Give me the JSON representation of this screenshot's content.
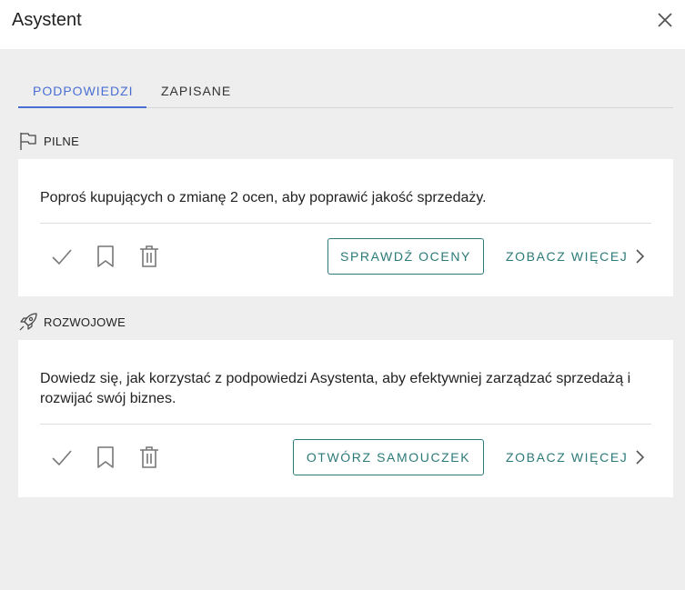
{
  "header": {
    "title": "Asystent",
    "close_icon": "close-icon"
  },
  "tabs": [
    {
      "label": "PODPOWIEDZI",
      "active": true
    },
    {
      "label": "ZAPISANE",
      "active": false
    }
  ],
  "colors": {
    "accent": "#4a6fd3",
    "teal": "#2b7a78",
    "background": "#eeeeee"
  },
  "sections": [
    {
      "label": "PILNE",
      "icon": "flag-icon",
      "card": {
        "text": "Poproś kupujących o zmianę 2 ocen, aby poprawić jakość sprzedaży.",
        "action_label": "SPRAWDŹ OCENY",
        "more_label": "ZOBACZ WIĘCEJ"
      }
    },
    {
      "label": "ROZWOJOWE",
      "icon": "rocket-icon",
      "card": {
        "text": "Dowiedz się, jak korzystać z podpowiedzi Asystenta, aby efektywniej zarządzać sprzedażą i rozwijać swój biznes.",
        "action_label": "OTWÓRZ SAMOUCZEK",
        "more_label": "ZOBACZ WIĘCEJ"
      }
    }
  ]
}
